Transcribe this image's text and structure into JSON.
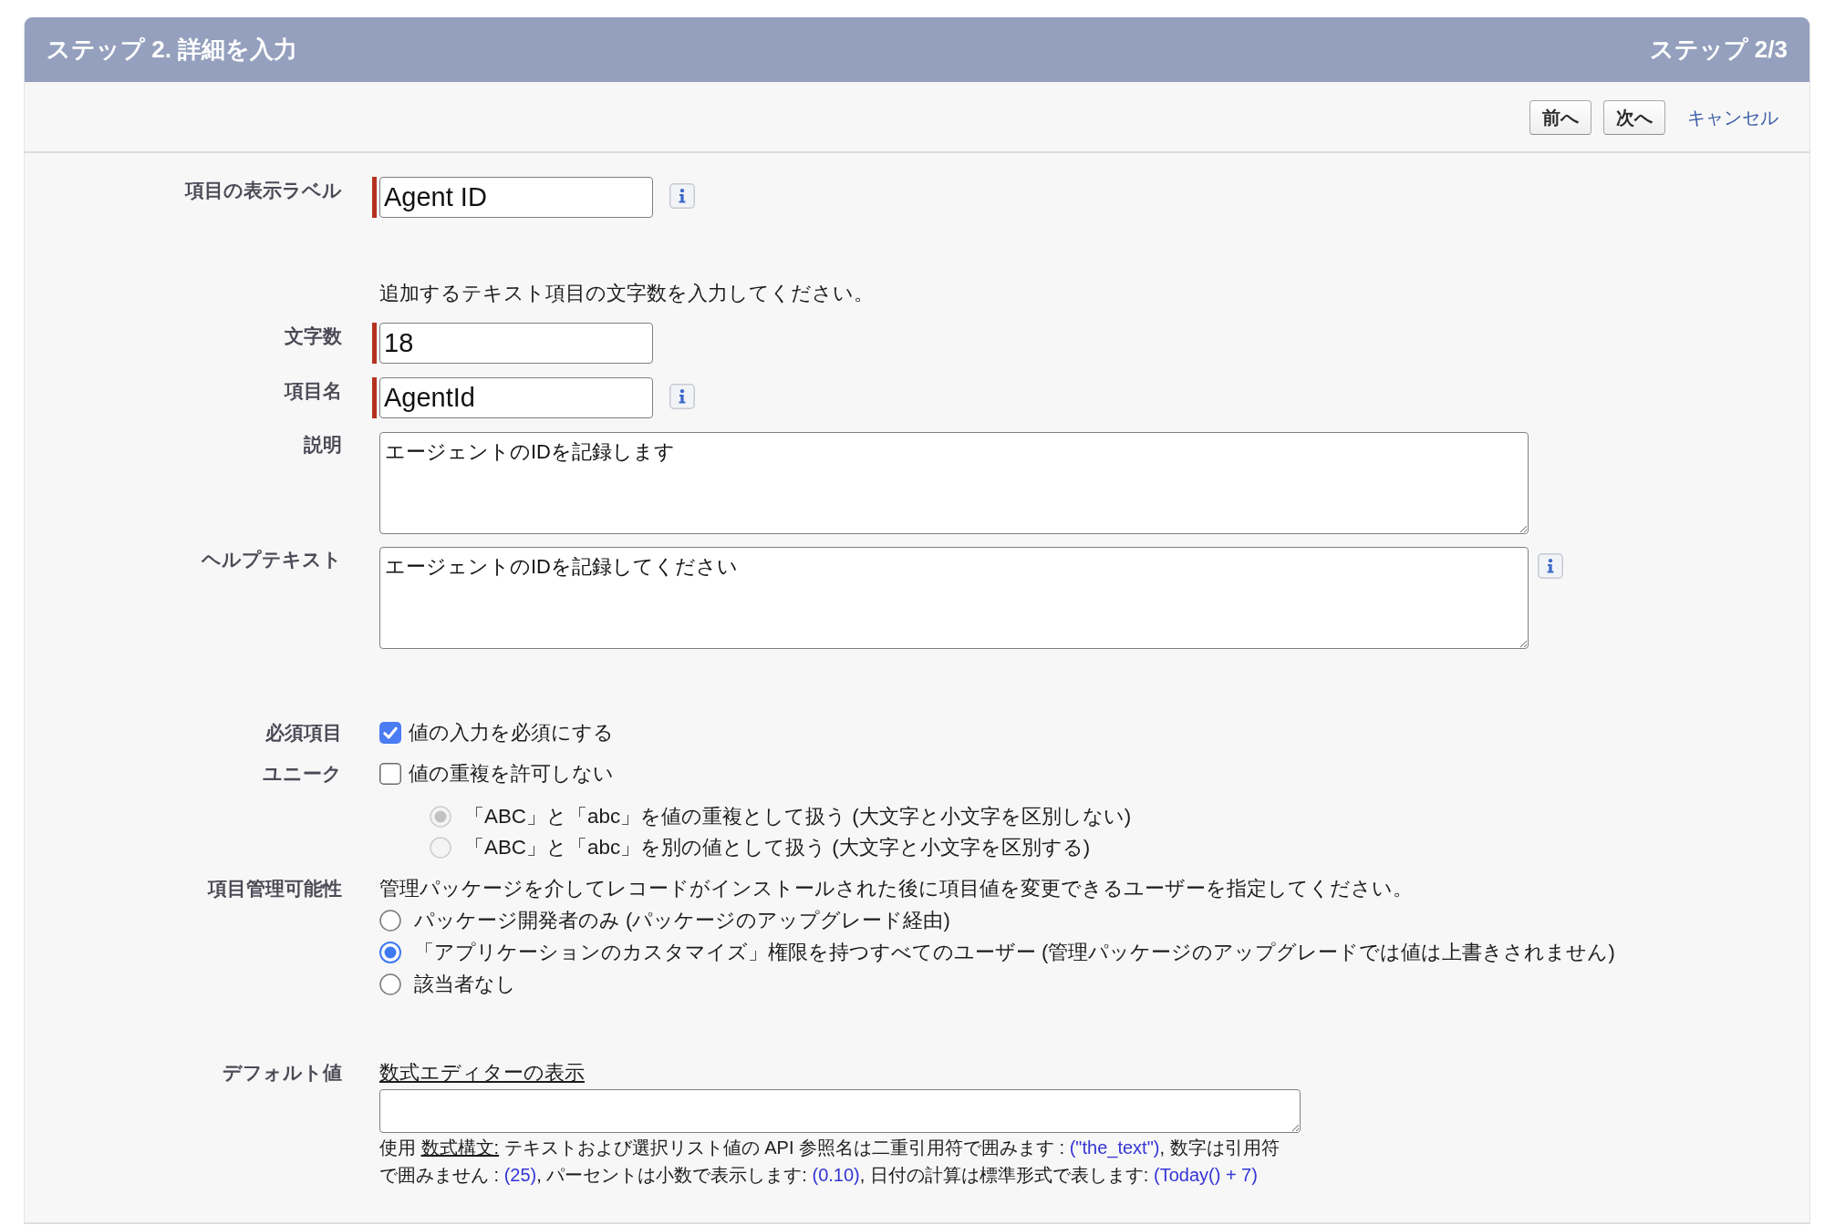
{
  "header": {
    "title": "ステップ 2. 詳細を入力",
    "step": "ステップ 2/3"
  },
  "toolbar": {
    "buttons": [
      {
        "kind": "button",
        "label": "前へ"
      },
      {
        "kind": "button",
        "label": "次へ"
      },
      {
        "kind": "link",
        "label": "キャンセル"
      }
    ]
  },
  "rows": [
    {
      "kind": "input",
      "label": "項目の表示ラベル",
      "value": "Agent ID",
      "required": true,
      "info": true
    },
    {
      "kind": "note",
      "text": "追加するテキスト項目の文字数を入力してください。"
    },
    {
      "kind": "input",
      "label": "文字数",
      "value": "18",
      "required": true,
      "info": false
    },
    {
      "kind": "input",
      "label": "項目名",
      "value": "AgentId",
      "required": true,
      "info": true
    },
    {
      "kind": "textarea",
      "label": "説明",
      "value": "エージェントのIDを記録します",
      "required": false,
      "info": false
    },
    {
      "kind": "textarea",
      "label": "ヘルプテキスト",
      "value": "エージェントのIDを記録してください",
      "required": false,
      "info": true
    },
    {
      "kind": "checkbox",
      "label": "必須項目",
      "text": "値の入力を必須にする",
      "checked": true
    },
    {
      "kind": "checkbox",
      "label": "ユニーク",
      "text": "値の重複を許可しない",
      "checked": false,
      "options": [
        {
          "text": "「ABC」と「abc」を値の重複として扱う (大文字と小文字を区別しない)",
          "selected": true,
          "disabled": true
        },
        {
          "text": "「ABC」と「abc」を別の値として扱う (大文字と小文字を区別する)",
          "selected": false,
          "disabled": true
        }
      ]
    },
    {
      "kind": "radio_group",
      "label": "項目管理可能性",
      "text": "管理パッケージを介してレコードがインストールされた後に項目値を変更できるユーザーを指定してください。",
      "options": [
        {
          "text": "パッケージ開発者のみ (パッケージのアップグレード経由)",
          "selected": false,
          "disabled": false
        },
        {
          "text": "「アプリケーションのカスタマイズ」権限を持つすべてのユーザー (管理パッケージのアップグレードでは値は上書きされません)",
          "selected": true,
          "disabled": false
        },
        {
          "text": "該当者なし",
          "selected": false,
          "disabled": false
        }
      ]
    },
    {
      "kind": "formula",
      "label": "デフォルト値",
      "link": "数式エディターの表示",
      "help": [
        {
          "kind": "text",
          "text": "使用 "
        },
        {
          "kind": "link",
          "text": "数式構文:"
        },
        {
          "kind": "text",
          "text": " テキストおよび選択リスト値の API 参照名は二重引用符で囲みます : "
        },
        {
          "kind": "code",
          "text": "(\"the_text\")"
        },
        {
          "kind": "text",
          "text": ", 数字は引用符で囲みません : "
        },
        {
          "kind": "code",
          "text": "(25)"
        },
        {
          "kind": "text",
          "text": ", パーセントは小数で表示します: "
        },
        {
          "kind": "code",
          "text": "(0.10)"
        },
        {
          "kind": "text",
          "text": ", 日付の計算は標準形式で表します: "
        },
        {
          "kind": "code",
          "text": "(Today() + 7)"
        }
      ]
    }
  ]
}
